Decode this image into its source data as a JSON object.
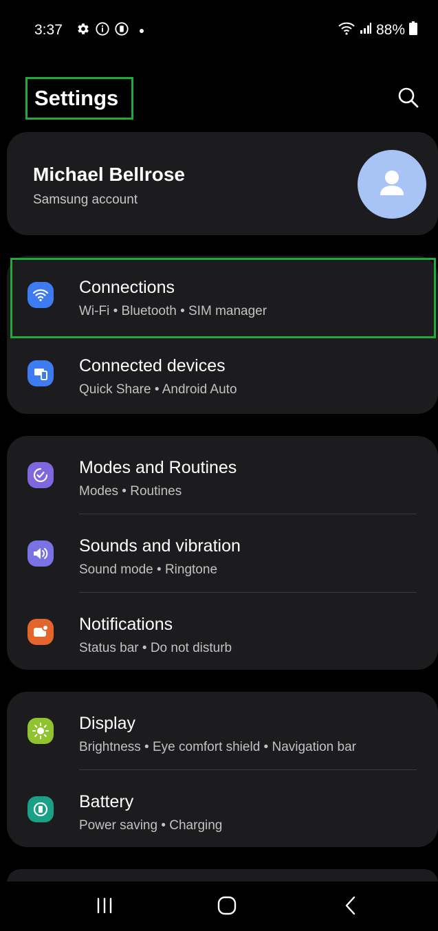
{
  "status_bar": {
    "time": "3:37",
    "battery": "88%",
    "left_icons": [
      "gear-icon",
      "info-icon",
      "battery-saver-icon",
      "dot-icon"
    ],
    "right_icons": [
      "wifi-icon",
      "signal-icon",
      "battery-icon"
    ]
  },
  "header": {
    "title": "Settings",
    "search_icon": "search-icon"
  },
  "account": {
    "name": "Michael Bellrose",
    "subtitle": "Samsung account"
  },
  "groups": [
    {
      "items": [
        {
          "title": "Connections",
          "subtitle": "Wi-Fi  •  Bluetooth  •  SIM manager",
          "icon": "wifi-icon",
          "color": "#3e7bf0"
        },
        {
          "title": "Connected devices",
          "subtitle": "Quick Share  •  Android Auto",
          "icon": "devices-icon",
          "color": "#3e7bf0"
        }
      ]
    },
    {
      "items": [
        {
          "title": "Modes and Routines",
          "subtitle": "Modes  •  Routines",
          "icon": "routine-check-icon",
          "color": "#7f67e0"
        },
        {
          "title": "Sounds and vibration",
          "subtitle": "Sound mode  •  Ringtone",
          "icon": "speaker-icon",
          "color": "#7a72e4"
        },
        {
          "title": "Notifications",
          "subtitle": "Status bar  •  Do not disturb",
          "icon": "notification-icon",
          "color": "#e5642d"
        }
      ]
    },
    {
      "items": [
        {
          "title": "Display",
          "subtitle": "Brightness  •  Eye comfort shield  •  Navigation bar",
          "icon": "sun-icon",
          "color": "#8fc330"
        },
        {
          "title": "Battery",
          "subtitle": "Power saving  •  Charging",
          "icon": "battery-care-icon",
          "color": "#1aa086"
        }
      ]
    }
  ],
  "nav_bar": {
    "recents_icon": "recents-icon",
    "home_icon": "home-icon",
    "back_icon": "back-icon"
  },
  "colors": {
    "highlight": "#1faa3a",
    "card_bg": "#1c1c1e",
    "avatar": "#a8c3f5"
  }
}
